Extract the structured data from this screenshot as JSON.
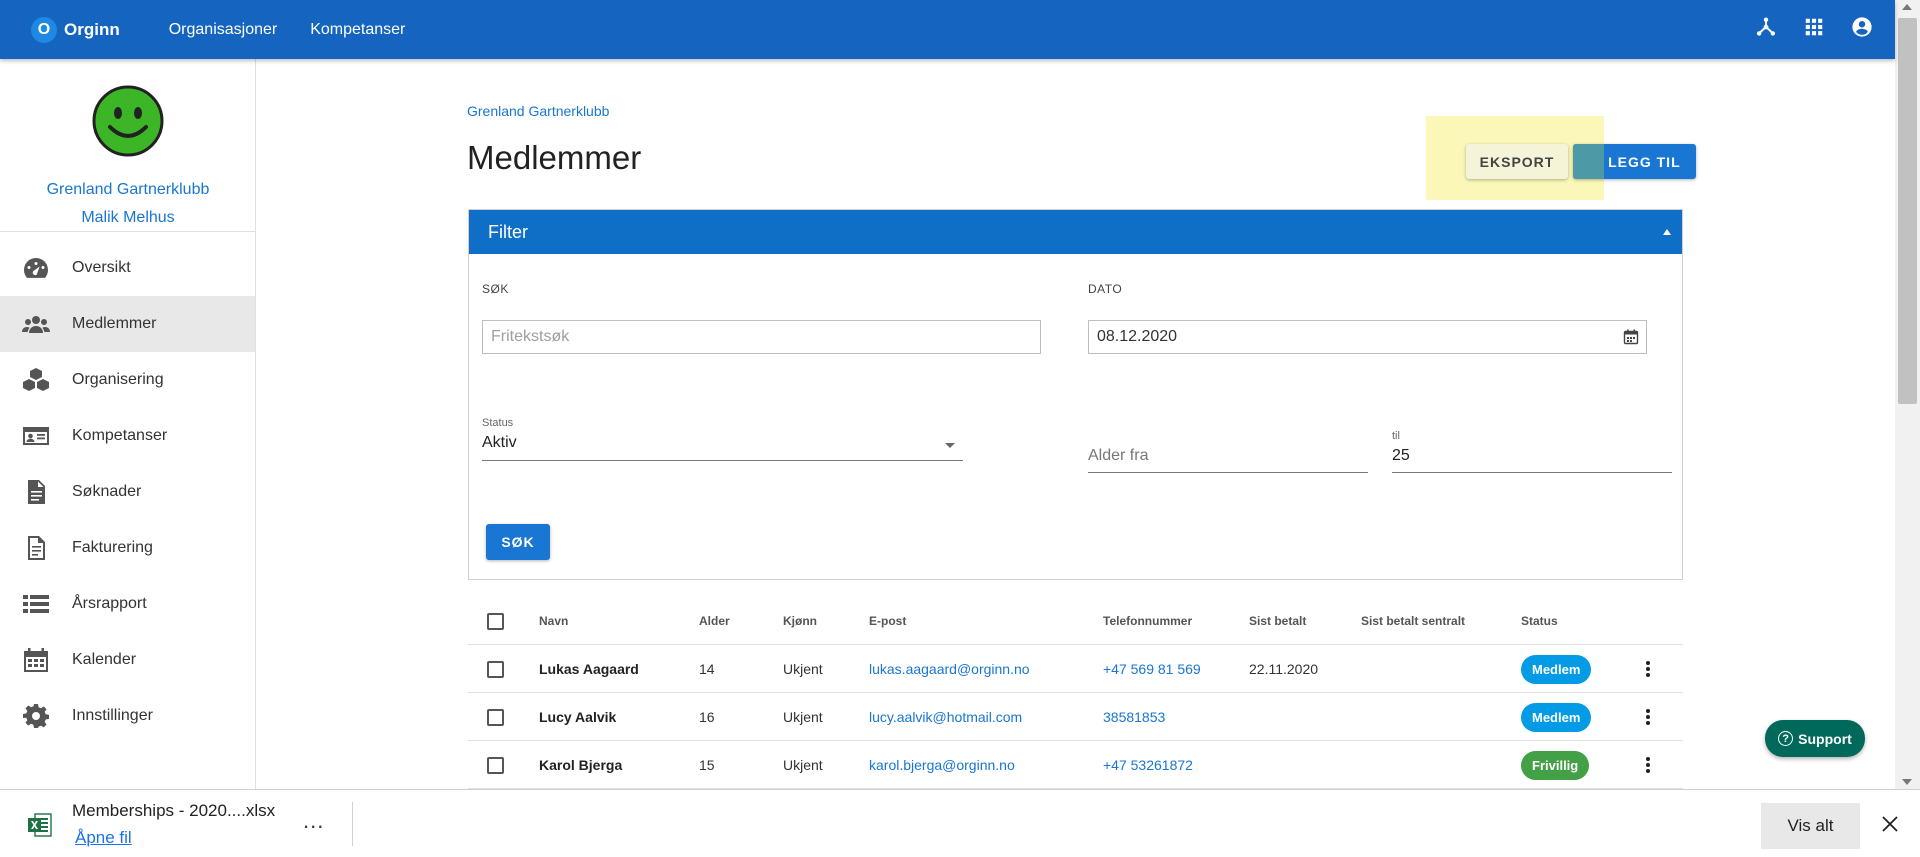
{
  "topbar": {
    "logo_letter": "O",
    "logo_text": "Orginn",
    "nav": [
      "Organisasjoner",
      "Kompetanser"
    ],
    "icons": [
      "hierarchy-icon",
      "apps-grid-icon",
      "account-icon"
    ]
  },
  "sidebar": {
    "org_name": "Grenland Gartnerklubb",
    "user_name": "Malik Melhus",
    "items": [
      {
        "label": "Oversikt",
        "icon": "speedometer-icon"
      },
      {
        "label": "Medlemmer",
        "icon": "people-icon",
        "active": true
      },
      {
        "label": "Organisering",
        "icon": "cubes-icon"
      },
      {
        "label": "Kompetanser",
        "icon": "id-card-icon"
      },
      {
        "label": "Søknader",
        "icon": "document-icon"
      },
      {
        "label": "Fakturering",
        "icon": "invoice-icon"
      },
      {
        "label": "Årsrapport",
        "icon": "list-icon"
      },
      {
        "label": "Kalender",
        "icon": "calendar-icon"
      },
      {
        "label": "Innstillinger",
        "icon": "gear-icon"
      }
    ]
  },
  "page": {
    "breadcrumb": "Grenland Gartnerklubb",
    "title": "Medlemmer",
    "export_label": "EKSPORT",
    "add_label": "LEGG TIL"
  },
  "filter": {
    "title": "Filter",
    "search_label": "SØK",
    "search_placeholder": "Fritekstsøk",
    "date_label": "DATO",
    "date_value": "08.12.2020",
    "status_label": "Status",
    "status_value": "Aktiv",
    "age_from_placeholder": "Alder fra",
    "age_to_label": "til",
    "age_to_value": "25",
    "search_button": "SØK"
  },
  "table": {
    "headers": [
      "Navn",
      "Alder",
      "Kjønn",
      "E-post",
      "Telefonnummer",
      "Sist betalt",
      "Sist betalt sentralt",
      "Status"
    ],
    "rows": [
      {
        "name": "Lukas Aagaard",
        "age": "14",
        "gender": "Ukjent",
        "email": "lukas.aagaard@orginn.no",
        "phone": "+47 569 81 569",
        "last_paid": "22.11.2020",
        "last_paid_central": "",
        "status": "Medlem",
        "status_color": "#039be5"
      },
      {
        "name": "Lucy Aalvik",
        "age": "16",
        "gender": "Ukjent",
        "email": "lucy.aalvik@hotmail.com",
        "phone": "38581853",
        "last_paid": "",
        "last_paid_central": "",
        "status": "Medlem",
        "status_color": "#039be5"
      },
      {
        "name": "Karol Bjerga",
        "age": "15",
        "gender": "Ukjent",
        "email": "karol.bjerga@orginn.no",
        "phone": "+47 53261872",
        "last_paid": "",
        "last_paid_central": "",
        "status": "Frivillig",
        "status_color": "#43a047"
      }
    ]
  },
  "support": {
    "label": "Support"
  },
  "download": {
    "file_name": "Memberships - 2020....xlsx",
    "open_label": "Åpne fil",
    "more": "...",
    "show_all": "Vis alt"
  },
  "colors": {
    "primary": "#1565c0",
    "highlight": "#fbf7b8",
    "support": "#00695c"
  }
}
